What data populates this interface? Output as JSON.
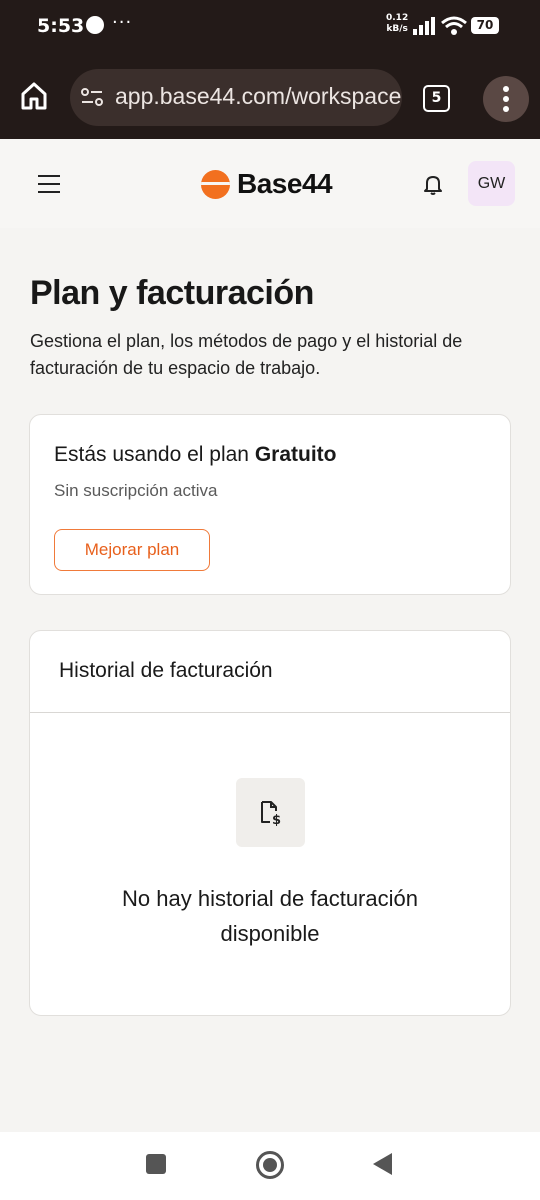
{
  "status_bar": {
    "time": "5:53",
    "more_indicator": "···",
    "net_speed_value": "0.12",
    "net_speed_unit": "kB/s",
    "battery": "70",
    "icons": [
      "app-notification-icon",
      "signal-icon",
      "wifi-icon",
      "battery-icon"
    ]
  },
  "browser": {
    "url": "app.base44.com/workspace",
    "tab_count": "5",
    "icons": [
      "home-icon",
      "site-settings-icon",
      "tabs-icon",
      "more-vert-icon"
    ]
  },
  "header": {
    "logo_text": "Base44",
    "avatar_initials": "GW",
    "brand_color": "#f2701f",
    "icons": [
      "hamburger-menu-icon",
      "bell-icon"
    ]
  },
  "page": {
    "title": "Plan y facturación",
    "description": "Gestiona el plan, los métodos de pago y el historial de facturación de tu espacio de trabajo."
  },
  "plan_card": {
    "prefix": "Estás usando el plan ",
    "plan_name": "Gratuito",
    "subscription_status": "Sin suscripción activa",
    "upgrade_button": "Mejorar plan"
  },
  "history_card": {
    "title": "Historial de facturación",
    "empty_message": "No hay historial de facturación disponible",
    "empty_icon": "invoice-dollar-icon"
  },
  "nav_bar": {
    "icons": [
      "recents-icon",
      "home-circle-icon",
      "back-icon"
    ]
  }
}
